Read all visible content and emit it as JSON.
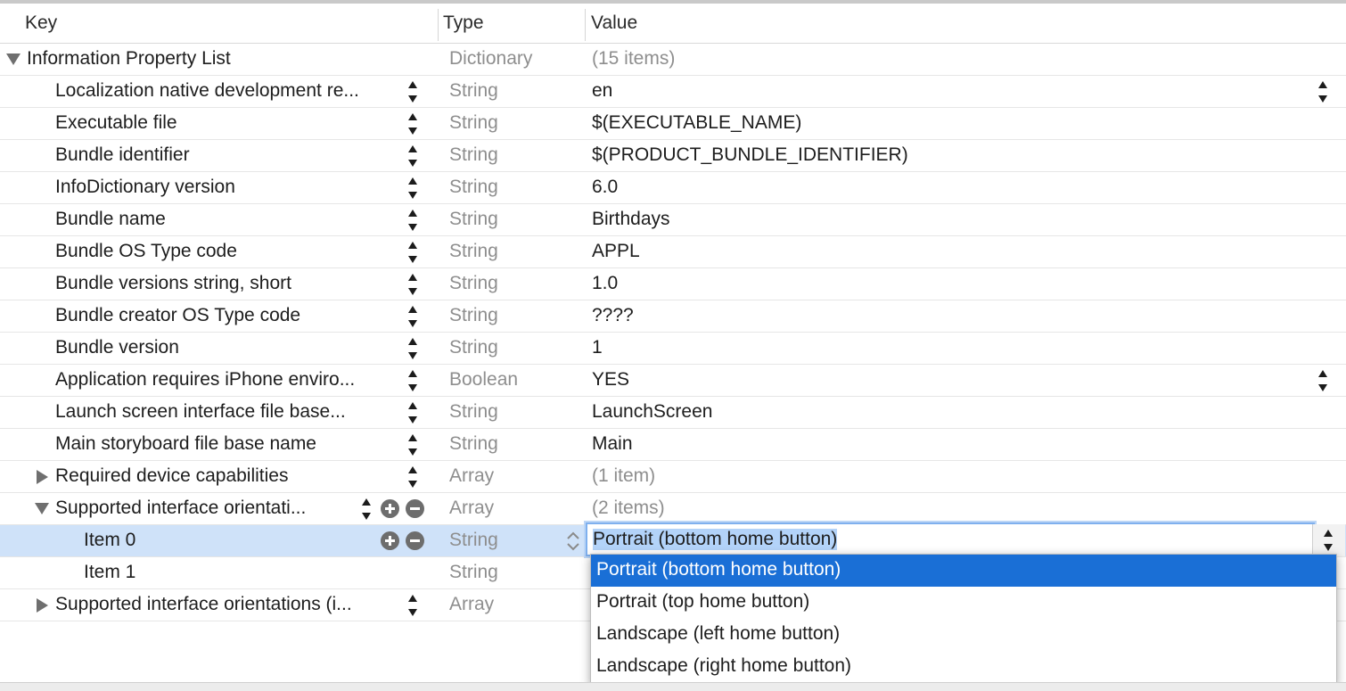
{
  "header": {
    "key": "Key",
    "type": "Type",
    "value": "Value"
  },
  "rows": [
    {
      "key": "Information Property List",
      "type": "Dictionary",
      "value": "(15 items)"
    },
    {
      "key": "Localization native development re...",
      "type": "String",
      "value": "en"
    },
    {
      "key": "Executable file",
      "type": "String",
      "value": "$(EXECUTABLE_NAME)"
    },
    {
      "key": "Bundle identifier",
      "type": "String",
      "value": "$(PRODUCT_BUNDLE_IDENTIFIER)"
    },
    {
      "key": "InfoDictionary version",
      "type": "String",
      "value": "6.0"
    },
    {
      "key": "Bundle name",
      "type": "String",
      "value": "Birthdays"
    },
    {
      "key": "Bundle OS Type code",
      "type": "String",
      "value": "APPL"
    },
    {
      "key": "Bundle versions string, short",
      "type": "String",
      "value": "1.0"
    },
    {
      "key": "Bundle creator OS Type code",
      "type": "String",
      "value": "????"
    },
    {
      "key": "Bundle version",
      "type": "String",
      "value": "1"
    },
    {
      "key": "Application requires iPhone enviro...",
      "type": "Boolean",
      "value": "YES"
    },
    {
      "key": "Launch screen interface file base...",
      "type": "String",
      "value": "LaunchScreen"
    },
    {
      "key": "Main storyboard file base name",
      "type": "String",
      "value": "Main"
    },
    {
      "key": "Required device capabilities",
      "type": "Array",
      "value": "(1 item)"
    },
    {
      "key": "Supported interface orientati...",
      "type": "Array",
      "value": "(2 items)"
    },
    {
      "key": "Item 0",
      "type": "String",
      "value": "Portrait (bottom home button)"
    },
    {
      "key": "Item 1",
      "type": "String",
      "value": ""
    },
    {
      "key": "Supported interface orientations (i...",
      "type": "Array",
      "value": ""
    }
  ],
  "dropdown": {
    "options": [
      "Portrait (bottom home button)",
      "Portrait (top home button)",
      "Landscape (left home button)",
      "Landscape (right home button)"
    ],
    "selected_index": 0
  },
  "colors": {
    "selection_row": "#cfe2f9",
    "menu_highlight": "#1a6fd6",
    "gray_text": "#8e8e8e"
  }
}
